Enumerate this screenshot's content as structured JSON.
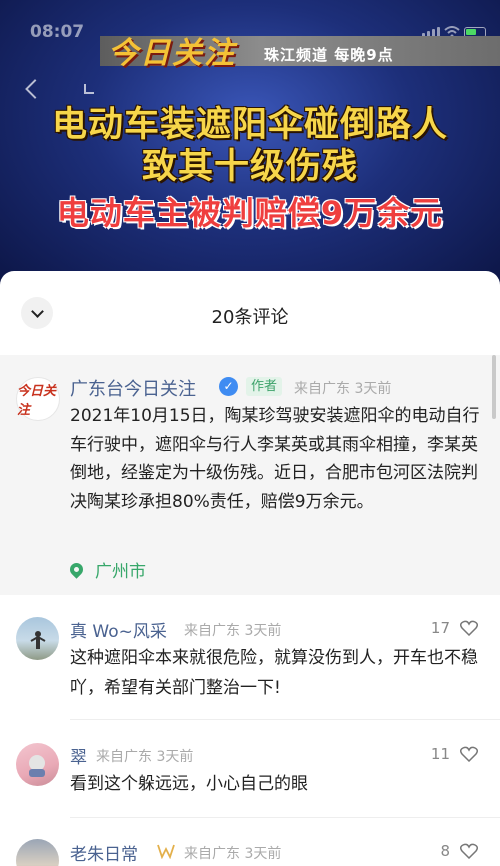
{
  "status": {
    "time": "08:07"
  },
  "video": {
    "logo": "今日关注",
    "channel": "珠江频道 每晚9点",
    "headline1": "电动车装遮阳伞碰倒路人",
    "headline2": "致其十级伤残",
    "headline3": "电动车主被判赔偿9万余元"
  },
  "sheet": {
    "title": "20条评论"
  },
  "post": {
    "avatar_text": "今日关注",
    "author": "广东台今日关注",
    "author_tag": "作者",
    "meta": "来自广东 3天前",
    "body": "2021年10月15日，陶某珍驾驶安装遮阳伞的电动自行车行驶中，遮阳伞与行人李某英或其雨伞相撞，李某英倒地，经鉴定为十级伤残。近日，合肥市包河区法院判决陶某珍承担80%责任，赔偿9万余元。",
    "location": "广州市"
  },
  "comments": [
    {
      "name": "真 Wo~风采",
      "meta": "来自广东 3天前",
      "likes": "17",
      "text": "这种遮阳伞本来就很危险，就算没伤到人，开车也不稳吖，希望有关部门整治一下!"
    },
    {
      "name": "翠",
      "meta": "来自广东 3天前",
      "likes": "11",
      "text": "看到这个躲远远，小心自己的眼"
    },
    {
      "name": "老朱日常",
      "meta": "来自广东 3天前",
      "likes": "8",
      "text": ""
    }
  ],
  "colors": {
    "accent_green": "#37a76a",
    "name_blue": "#4a6290",
    "verified_blue": "#3f8cf2"
  }
}
